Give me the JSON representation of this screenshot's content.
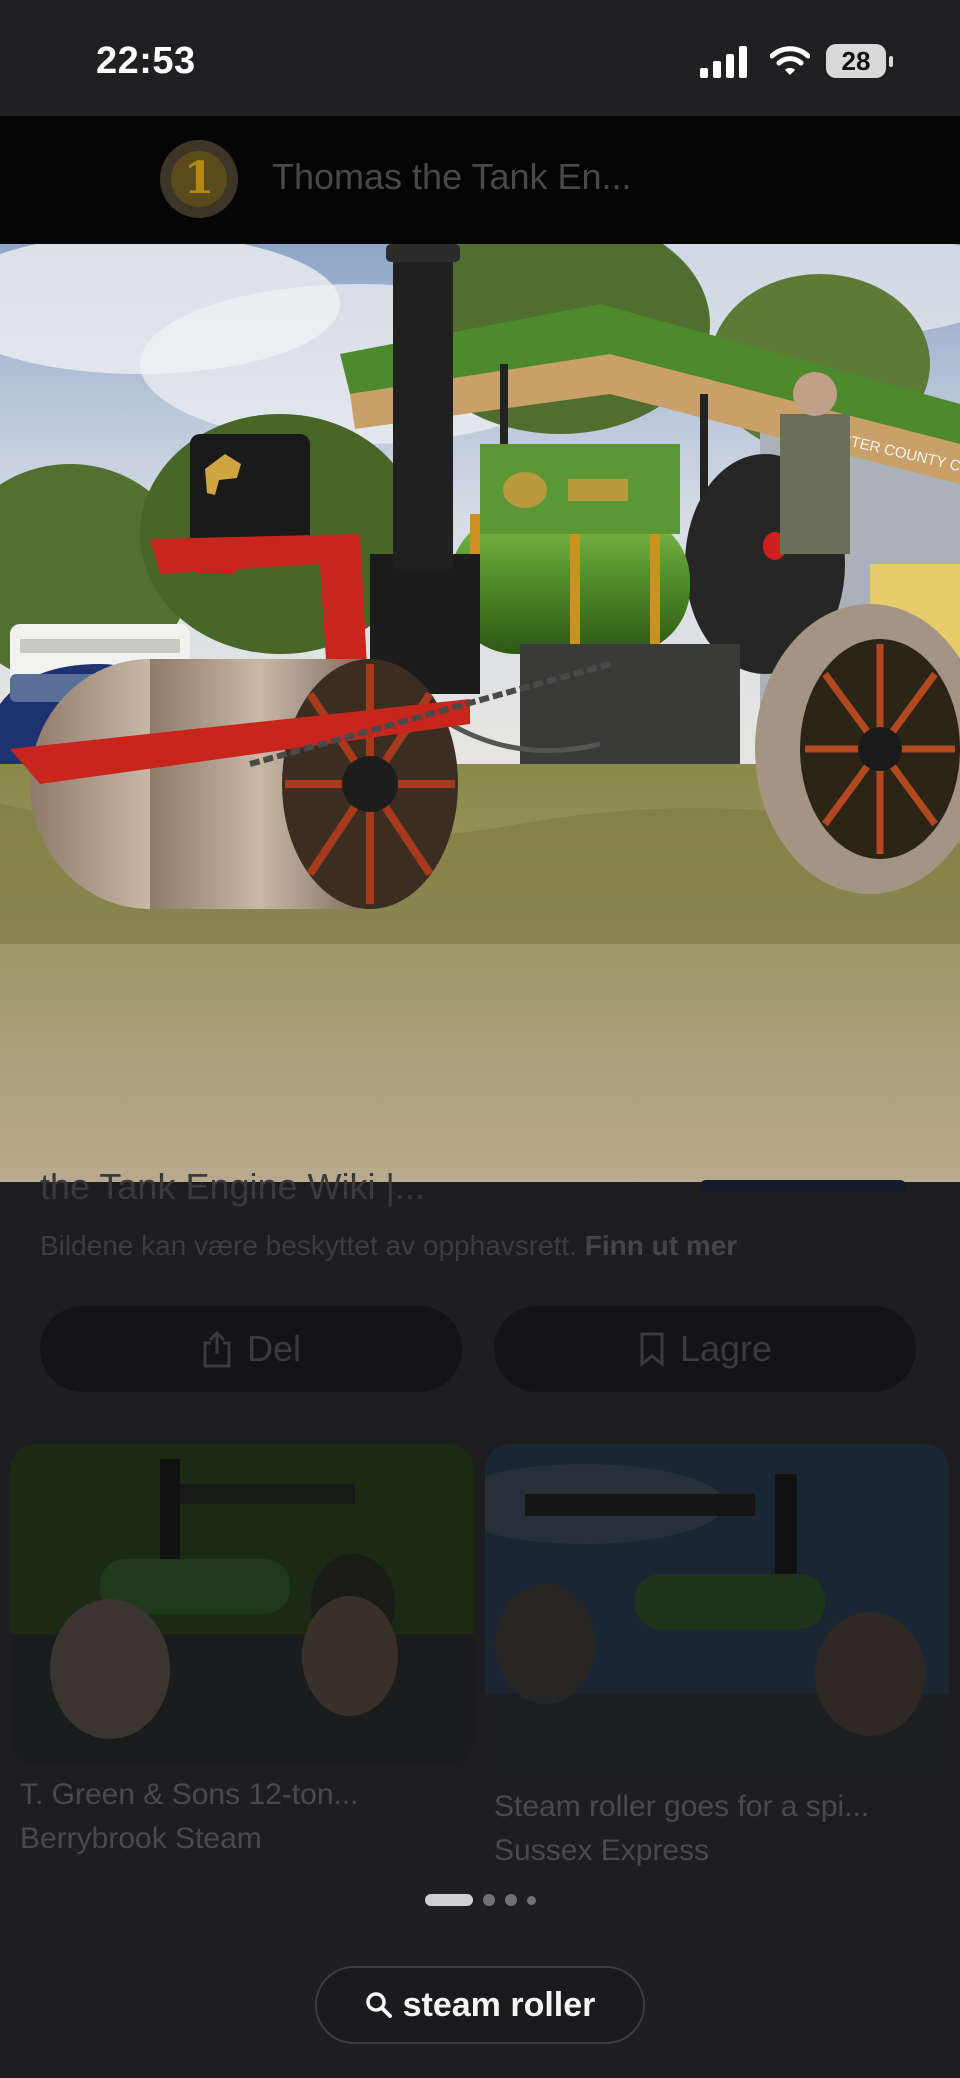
{
  "status_bar": {
    "time": "22:53",
    "battery": "28"
  },
  "header": {
    "source_logo_text": "1",
    "title": "Thomas the Tank En..."
  },
  "main_image": {
    "canopy_text": "LEICESTER COUNTY COUNCIL HIGH"
  },
  "result": {
    "title": "the Tank Engine Wiki |...",
    "copyright_text": "Bildene kan være beskyttet av opphavsrett.",
    "learn_more": "Finn ut mer"
  },
  "actions": {
    "share_label": "Del",
    "save_label": "Lagre"
  },
  "related": [
    {
      "title": "T. Green & Sons 12-ton...",
      "source": "Berrybrook Steam"
    },
    {
      "title": "Steam roller goes for a spi...",
      "source": "Sussex Express"
    }
  ],
  "search": {
    "query": "steam roller"
  },
  "colors": {
    "background": "#1e1e20",
    "header_bg": "#050505",
    "engine_green": "#5a9a2e",
    "roller_red": "#c8261c"
  }
}
